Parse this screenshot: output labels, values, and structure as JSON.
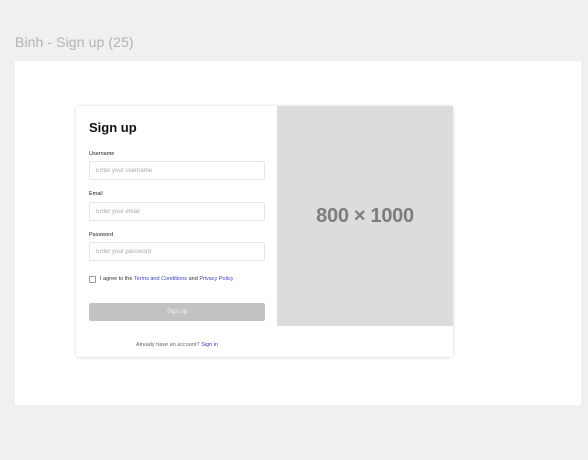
{
  "frame": {
    "title": "Binh - Sign up (25)"
  },
  "form": {
    "title": "Sign up",
    "username": {
      "label": "Username",
      "placeholder": "Enter your username",
      "value": ""
    },
    "email": {
      "label": "Email",
      "placeholder": "Enter your email",
      "value": ""
    },
    "password": {
      "label": "Password",
      "placeholder": "Enter your password",
      "value": ""
    },
    "agree": {
      "checked": false,
      "prefix": "I agree to the",
      "terms_link": "Terms and Conditions",
      "and": "and",
      "privacy_link": "Privacy Policy"
    },
    "submit_label": "Sign up",
    "signin_prompt": "Already have an account?",
    "signin_link": "Sign in"
  },
  "image_placeholder": {
    "text": "800 × 1000"
  },
  "colors": {
    "link": "#3d3dc8",
    "button_disabled": "#c2c2c2",
    "image_placeholder_bg": "#dcdcdc"
  }
}
